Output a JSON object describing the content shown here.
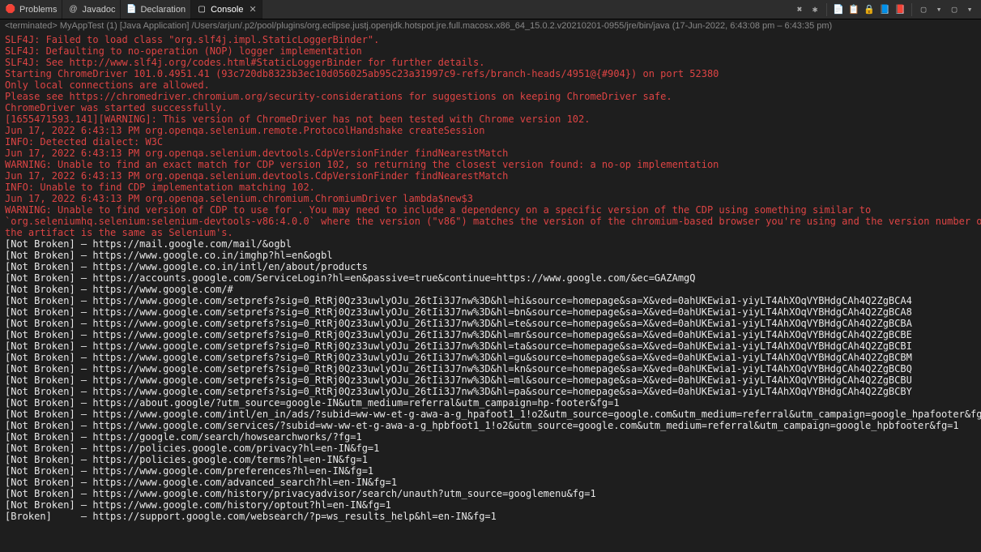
{
  "tabs": [
    {
      "icon": "🛑",
      "label": "Problems"
    },
    {
      "icon": "@",
      "label": "Javadoc"
    },
    {
      "icon": "📄",
      "label": "Declaration"
    },
    {
      "icon": "▢",
      "label": "Console"
    }
  ],
  "toolbar": {
    "btn1": "✖",
    "btn2": "✱",
    "btn3": "📄",
    "btn4": "📋",
    "btn5": "🔒",
    "btn6": "📘",
    "btn7": "📕",
    "btn8": "▢",
    "btn9": "▤",
    "btn10": "▾",
    "btn11": "▢",
    "btn12": "▾"
  },
  "status": {
    "terminated": "<terminated>",
    "app": "MyAppTest (1) [Java Application]",
    "path": "/Users/arjun/.p2/pool/plugins/org.eclipse.justj.openjdk.hotspot.jre.full.macosx.x86_64_15.0.2.v20210201-0955/jre/bin/java",
    "timestamp": "(17-Jun-2022, 6:43:08 pm – 6:43:35 pm)"
  },
  "log": [
    {
      "c": "red",
      "t": "SLF4J: Failed to load class \"org.slf4j.impl.StaticLoggerBinder\"."
    },
    {
      "c": "red",
      "t": "SLF4J: Defaulting to no-operation (NOP) logger implementation"
    },
    {
      "c": "red",
      "t": "SLF4J: See http://www.slf4j.org/codes.html#StaticLoggerBinder for further details."
    },
    {
      "c": "red",
      "t": "Starting ChromeDriver 101.0.4951.41 (93c720db8323b3ec10d056025ab95c23a31997c9-refs/branch-heads/4951@{#904}) on port 52380"
    },
    {
      "c": "red",
      "t": "Only local connections are allowed."
    },
    {
      "c": "red",
      "t": "Please see https://chromedriver.chromium.org/security-considerations for suggestions on keeping ChromeDriver safe."
    },
    {
      "c": "red",
      "t": "ChromeDriver was started successfully."
    },
    {
      "c": "red",
      "t": "[1655471593.141][WARNING]: This version of ChromeDriver has not been tested with Chrome version 102."
    },
    {
      "c": "red",
      "t": "Jun 17, 2022 6:43:13 PM org.openqa.selenium.remote.ProtocolHandshake createSession"
    },
    {
      "c": "red",
      "t": "INFO: Detected dialect: W3C"
    },
    {
      "c": "red",
      "t": "Jun 17, 2022 6:43:13 PM org.openqa.selenium.devtools.CdpVersionFinder findNearestMatch"
    },
    {
      "c": "red",
      "t": "WARNING: Unable to find an exact match for CDP version 102, so returning the closest version found: a no-op implementation"
    },
    {
      "c": "red",
      "t": "Jun 17, 2022 6:43:13 PM org.openqa.selenium.devtools.CdpVersionFinder findNearestMatch"
    },
    {
      "c": "red",
      "t": "INFO: Unable to find CDP implementation matching 102."
    },
    {
      "c": "red",
      "t": "Jun 17, 2022 6:43:13 PM org.openqa.selenium.chromium.ChromiumDriver lambda$new$3"
    },
    {
      "c": "red",
      "t": "WARNING: Unable to find version of CDP to use for . You may need to include a dependency on a specific version of the CDP using something similar to"
    },
    {
      "c": "red",
      "t": "`org.seleniumhq.selenium:selenium-devtools-v86:4.0.0` where the version (\"v86\") matches the version of the chromium-based browser you're using and the version number o"
    },
    {
      "c": "red",
      "t": "the artifact is the same as Selenium's."
    },
    {
      "c": "white",
      "t": "[Not Broken] – https://mail.google.com/mail/&ogbl"
    },
    {
      "c": "white",
      "t": "[Not Broken] – https://www.google.co.in/imghp?hl=en&ogbl"
    },
    {
      "c": "white",
      "t": "[Not Broken] – https://www.google.co.in/intl/en/about/products"
    },
    {
      "c": "white",
      "t": "[Not Broken] – https://accounts.google.com/ServiceLogin?hl=en&passive=true&continue=https://www.google.com/&ec=GAZAmgQ"
    },
    {
      "c": "white",
      "t": "[Not Broken] – https://www.google.com/#"
    },
    {
      "c": "white",
      "t": "[Not Broken] – https://www.google.com/setprefs?sig=0_RtRj0Qz33uwlyOJu_26tIi3J7nw%3D&hl=hi&source=homepage&sa=X&ved=0ahUKEwia1-yiyLT4AhXOqVYBHdgCAh4Q2ZgBCA4"
    },
    {
      "c": "white",
      "t": "[Not Broken] – https://www.google.com/setprefs?sig=0_RtRj0Qz33uwlyOJu_26tIi3J7nw%3D&hl=bn&source=homepage&sa=X&ved=0ahUKEwia1-yiyLT4AhXOqVYBHdgCAh4Q2ZgBCA8"
    },
    {
      "c": "white",
      "t": "[Not Broken] – https://www.google.com/setprefs?sig=0_RtRj0Qz33uwlyOJu_26tIi3J7nw%3D&hl=te&source=homepage&sa=X&ved=0ahUKEwia1-yiyLT4AhXOqVYBHdgCAh4Q2ZgBCBA"
    },
    {
      "c": "white",
      "t": "[Not Broken] – https://www.google.com/setprefs?sig=0_RtRj0Qz33uwlyOJu_26tIi3J7nw%3D&hl=mr&source=homepage&sa=X&ved=0ahUKEwia1-yiyLT4AhXOqVYBHdgCAh4Q2ZgBCBE"
    },
    {
      "c": "white",
      "t": "[Not Broken] – https://www.google.com/setprefs?sig=0_RtRj0Qz33uwlyOJu_26tIi3J7nw%3D&hl=ta&source=homepage&sa=X&ved=0ahUKEwia1-yiyLT4AhXOqVYBHdgCAh4Q2ZgBCBI"
    },
    {
      "c": "white",
      "t": "[Not Broken] – https://www.google.com/setprefs?sig=0_RtRj0Qz33uwlyOJu_26tIi3J7nw%3D&hl=gu&source=homepage&sa=X&ved=0ahUKEwia1-yiyLT4AhXOqVYBHdgCAh4Q2ZgBCBM"
    },
    {
      "c": "white",
      "t": "[Not Broken] – https://www.google.com/setprefs?sig=0_RtRj0Qz33uwlyOJu_26tIi3J7nw%3D&hl=kn&source=homepage&sa=X&ved=0ahUKEwia1-yiyLT4AhXOqVYBHdgCAh4Q2ZgBCBQ"
    },
    {
      "c": "white",
      "t": "[Not Broken] – https://www.google.com/setprefs?sig=0_RtRj0Qz33uwlyOJu_26tIi3J7nw%3D&hl=ml&source=homepage&sa=X&ved=0ahUKEwia1-yiyLT4AhXOqVYBHdgCAh4Q2ZgBCBU"
    },
    {
      "c": "white",
      "t": "[Not Broken] – https://www.google.com/setprefs?sig=0_RtRj0Qz33uwlyOJu_26tIi3J7nw%3D&hl=pa&source=homepage&sa=X&ved=0ahUKEwia1-yiyLT4AhXOqVYBHdgCAh4Q2ZgBCBY"
    },
    {
      "c": "white",
      "t": "[Not Broken] – https://about.google/?utm_source=google-IN&utm_medium=referral&utm_campaign=hp-footer&fg=1"
    },
    {
      "c": "white",
      "t": "[Not Broken] – https://www.google.com/intl/en_in/ads/?subid=ww-ww-et-g-awa-a-g_hpafoot1_1!o2&utm_source=google.com&utm_medium=referral&utm_campaign=google_hpafooter&fg"
    },
    {
      "c": "white",
      "t": "[Not Broken] – https://www.google.com/services/?subid=ww-ww-et-g-awa-a-g_hpbfoot1_1!o2&utm_source=google.com&utm_medium=referral&utm_campaign=google_hpbfooter&fg=1"
    },
    {
      "c": "white",
      "t": "[Not Broken] – https://google.com/search/howsearchworks/?fg=1"
    },
    {
      "c": "white",
      "t": "[Not Broken] – https://policies.google.com/privacy?hl=en-IN&fg=1"
    },
    {
      "c": "white",
      "t": "[Not Broken] – https://policies.google.com/terms?hl=en-IN&fg=1"
    },
    {
      "c": "white",
      "t": "[Not Broken] – https://www.google.com/preferences?hl=en-IN&fg=1"
    },
    {
      "c": "white",
      "t": "[Not Broken] – https://www.google.com/advanced_search?hl=en-IN&fg=1"
    },
    {
      "c": "white",
      "t": "[Not Broken] – https://www.google.com/history/privacyadvisor/search/unauth?utm_source=googlemenu&fg=1"
    },
    {
      "c": "white",
      "t": "[Not Broken] – https://www.google.com/history/optout?hl=en-IN&fg=1"
    },
    {
      "c": "white",
      "t": "[Broken]     – https://support.google.com/websearch/?p=ws_results_help&hl=en-IN&fg=1"
    }
  ]
}
